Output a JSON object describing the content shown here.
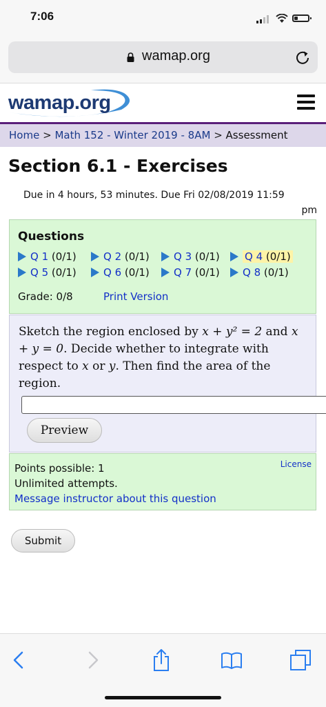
{
  "status": {
    "time": "7:06"
  },
  "browser": {
    "url": "wamap.org"
  },
  "site": {
    "logo": "wamap.org"
  },
  "breadcrumb": {
    "home": "Home",
    "course": "Math 152 - Winter 2019 - 8AM",
    "current": "Assessment",
    "separator": ">"
  },
  "page": {
    "title": "Section 6.1 - Exercises",
    "due_line1": "Due in 4 hours, 53 minutes. Due Fri 02/08/2019 11:59",
    "due_line2": "pm"
  },
  "questions": {
    "heading": "Questions",
    "items": [
      {
        "label": "Q 1",
        "score": "(0/1)"
      },
      {
        "label": "Q 2",
        "score": "(0/1)"
      },
      {
        "label": "Q 3",
        "score": "(0/1)"
      },
      {
        "label": "Q 4",
        "score": "(0/1)"
      },
      {
        "label": "Q 5",
        "score": "(0/1)"
      },
      {
        "label": "Q 6",
        "score": "(0/1)"
      },
      {
        "label": "Q 7",
        "score": "(0/1)"
      },
      {
        "label": "Q 8",
        "score": "(0/1)"
      }
    ],
    "current_index": 3,
    "grade": "Grade: 0/8",
    "print_version": "Print Version"
  },
  "question": {
    "text_parts": {
      "p1": "Sketch the region enclosed by ",
      "eq1": "x + y² = 2",
      "p2": " and ",
      "eq2": "x + y = 0",
      "p3": ". Decide whether to integrate with respect to ",
      "var1": "x",
      "p4": " or ",
      "var2": "y",
      "p5": ". Then find the area of the region."
    },
    "answer_value": "",
    "preview_label": "Preview"
  },
  "points": {
    "possible": "Points possible: 1",
    "attempts": "Unlimited attempts.",
    "message_link": "Message instructor about this question",
    "license": "License"
  },
  "submit_label": "Submit",
  "colors": {
    "accent_purple": "#5a1f7a",
    "link_blue": "#1330c8",
    "safari_blue": "#2a7ef0",
    "green_box": "#daf8d6",
    "question_box": "#ededf9",
    "highlight": "#fdf3a7"
  },
  "icons": {
    "lock": "lock-icon",
    "reload": "reload-icon",
    "menu": "hamburger-menu-icon",
    "back": "chevron-left-icon",
    "forward": "chevron-right-icon",
    "share": "share-icon",
    "bookmarks": "book-icon",
    "tabs": "tabs-icon"
  }
}
